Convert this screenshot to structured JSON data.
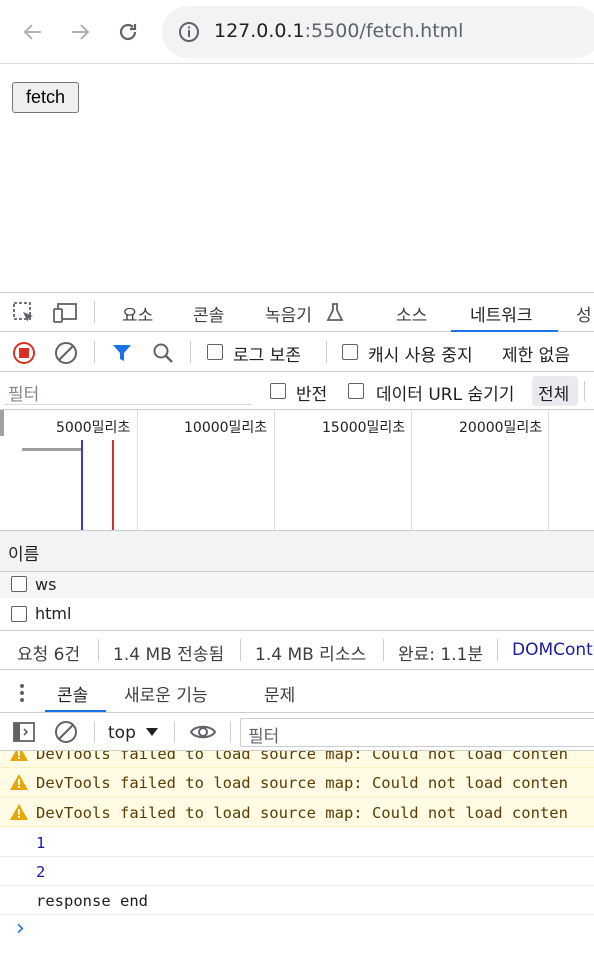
{
  "browser": {
    "url_host": "127.0.0.1",
    "url_path": ":5500/fetch.html"
  },
  "page": {
    "fetch_button": "fetch"
  },
  "devtools": {
    "main_tabs": [
      "요소",
      "콘솔",
      "녹음기",
      "소스",
      "네트워크",
      "성"
    ],
    "active_main_tab": "네트워크",
    "network_toolbar": {
      "preserve_log": "로그 보존",
      "disable_cache": "캐시 사용 중지",
      "throttling": "제한 없음"
    },
    "filter_bar": {
      "placeholder": "필터",
      "invert": "반전",
      "hide_data_urls": "데이터 URL 숨기기",
      "all": "전체"
    },
    "overview_ticks": [
      "5000밀리초",
      "10000밀리초",
      "15000밀리초",
      "20000밀리초"
    ],
    "requests_header": "이름",
    "requests": [
      "ws",
      "html"
    ],
    "summary": {
      "requests": "요청 6건",
      "transferred": "1.4 MB 전송됨",
      "resources": "1.4 MB 리소스",
      "finish": "완료: 1.1분",
      "domcontent": "DOMConte"
    },
    "drawer_tabs": [
      "콘솔",
      "새로운 기능",
      "문제"
    ],
    "active_drawer_tab": "콘솔",
    "console_toolbar": {
      "context": "top",
      "filter_placeholder": "필터"
    },
    "console_messages": [
      {
        "level": "warning",
        "text": "DevTools failed to load source map: Could not load conten"
      },
      {
        "level": "warning",
        "text": "DevTools failed to load source map: Could not load conten"
      },
      {
        "level": "warning",
        "text": "DevTools failed to load source map: Could not load conten"
      },
      {
        "level": "log",
        "text": "1"
      },
      {
        "level": "log",
        "text": "2"
      },
      {
        "level": "log",
        "text": "response end"
      }
    ],
    "prompt_symbol": "›"
  },
  "colors": {
    "accent": "#1a73e8",
    "record_red": "#d93025",
    "warning_bg": "#fffbe5",
    "warning_text": "#5c3c00",
    "number_blue": "#1a1aa6"
  }
}
